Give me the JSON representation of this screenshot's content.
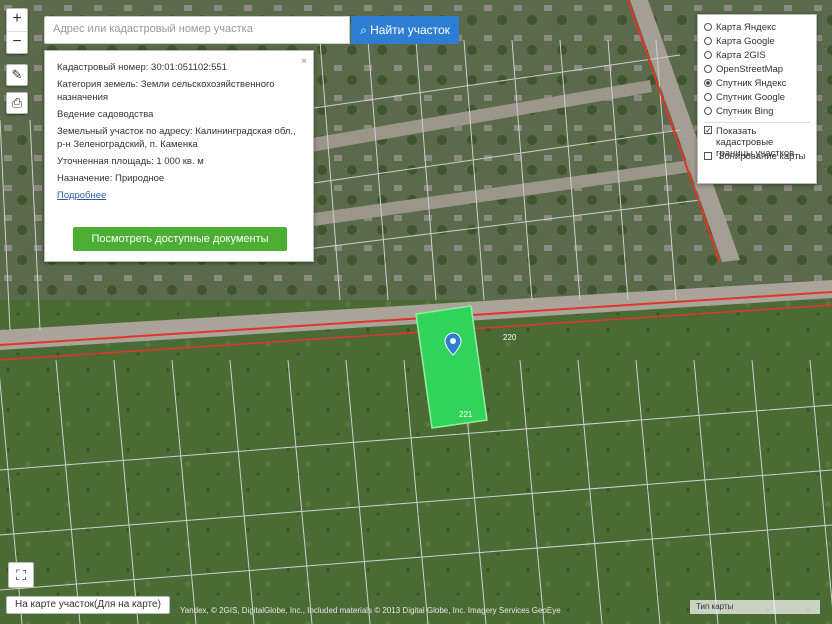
{
  "colors": {
    "selected_parcel": "#32d35a",
    "parcel_border": "#c8c8c8",
    "highlight_border": "#e0352b",
    "search_button": "#2d7dd2",
    "docs_button": "#4caf34"
  },
  "icons": {
    "zoom_in": "plus-icon",
    "zoom_out": "minus-icon",
    "ruler": "ruler-icon",
    "print": "printer-icon",
    "search": "search-icon",
    "fullscreen": "fullscreen-icon",
    "marker": "map-marker-icon",
    "close": "close-icon"
  },
  "search": {
    "placeholder": "Адрес или кадастровый номер участка",
    "button_label": "Найти участок"
  },
  "info_card": {
    "cadastral_number": "Кадастровый номер: 30:01:051102:551",
    "category": "Категория земель: Земли сельскохозяйственного назначения",
    "use": "Ведение садоводства",
    "address": "Земельный участок по адресу: Калининградская обл., р-н Зеленоградский, п. Каменка",
    "area": "Уточненная площадь: 1 000 кв. м",
    "ownership": "Назначение: Природное",
    "more_link": "Подробнее",
    "docs_button": "Посмотреть доступные документы",
    "close_label": "×"
  },
  "layers": {
    "options": [
      {
        "label": "Карта Яндекс",
        "selected": false
      },
      {
        "label": "Карта Google",
        "selected": false
      },
      {
        "label": "Карта 2GIS",
        "selected": false
      },
      {
        "label": "OpenStreetMap",
        "selected": false
      },
      {
        "label": "Спутник Яндекс",
        "selected": true
      },
      {
        "label": "Спутник Google",
        "selected": false
      },
      {
        "label": "Спутник Bing",
        "selected": false
      }
    ],
    "checkbox_cadastral": "Показать кадастровые границы участков",
    "checkbox_cadastral_checked": true,
    "checkbox_other": "Зонирование карты",
    "checkbox_other_checked": false
  },
  "bottom_bar": "На карте участок(Для на карте)",
  "copyright": "Yandex, © 2GIS, DigitalGlobe, Inc., Included materials © 2013 Digital Globe, Inc. Imagery Services GeoEye",
  "scale_label": "Тип карты",
  "parcel_labels": {
    "selected": "221",
    "neighbor": "220"
  }
}
